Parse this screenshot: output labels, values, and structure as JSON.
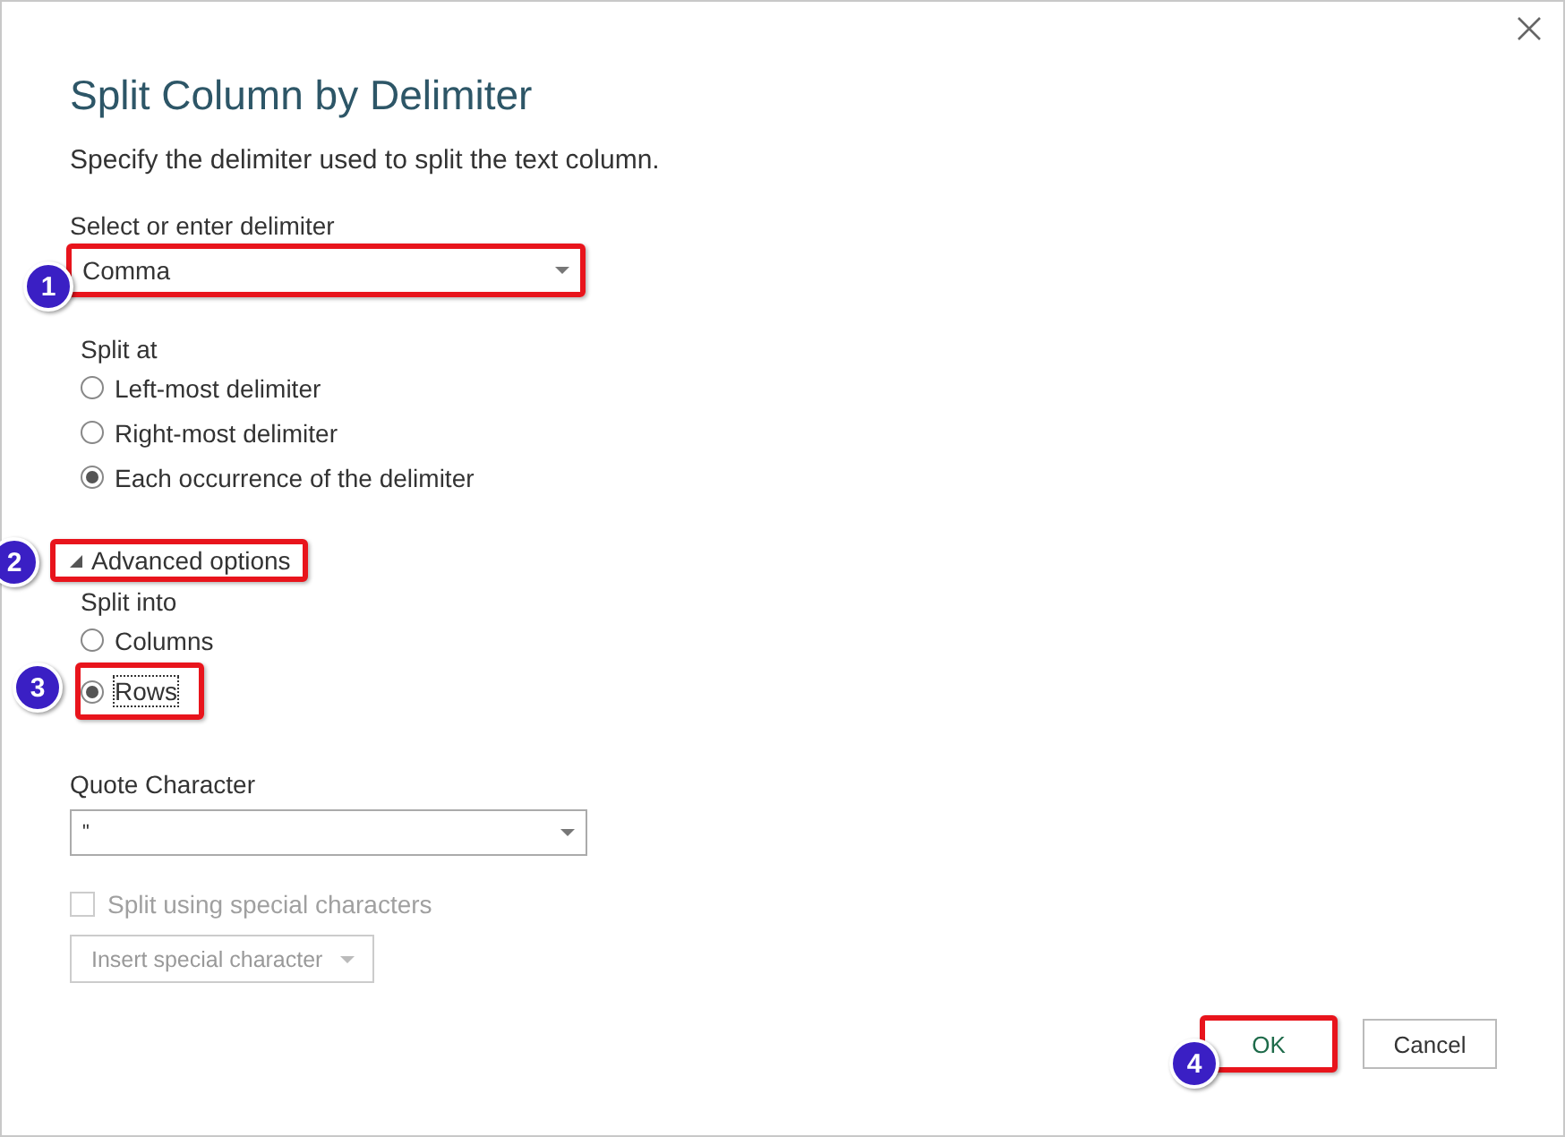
{
  "title": "Split Column by Delimiter",
  "description": "Specify the delimiter used to split the text column.",
  "delimiter": {
    "label": "Select or enter delimiter",
    "value": "Comma",
    "callout": "1"
  },
  "split_at": {
    "label": "Split at",
    "options": [
      {
        "label": "Left-most delimiter",
        "selected": false
      },
      {
        "label": "Right-most delimiter",
        "selected": false
      },
      {
        "label": "Each occurrence of the delimiter",
        "selected": true
      }
    ]
  },
  "advanced": {
    "label": "Advanced options",
    "expanded": true,
    "callout": "2"
  },
  "split_into": {
    "label": "Split into",
    "options": [
      {
        "label": "Columns",
        "selected": false
      },
      {
        "label": "Rows",
        "selected": true,
        "callout": "3"
      }
    ]
  },
  "quote": {
    "label": "Quote Character",
    "value": "\""
  },
  "special": {
    "label": "Split using special characters",
    "checked": false,
    "disabled": true
  },
  "insert_button": {
    "label": "Insert special character",
    "disabled": true
  },
  "buttons": [
    {
      "label": "OK",
      "callout": "4"
    },
    {
      "label": "Cancel"
    }
  ]
}
